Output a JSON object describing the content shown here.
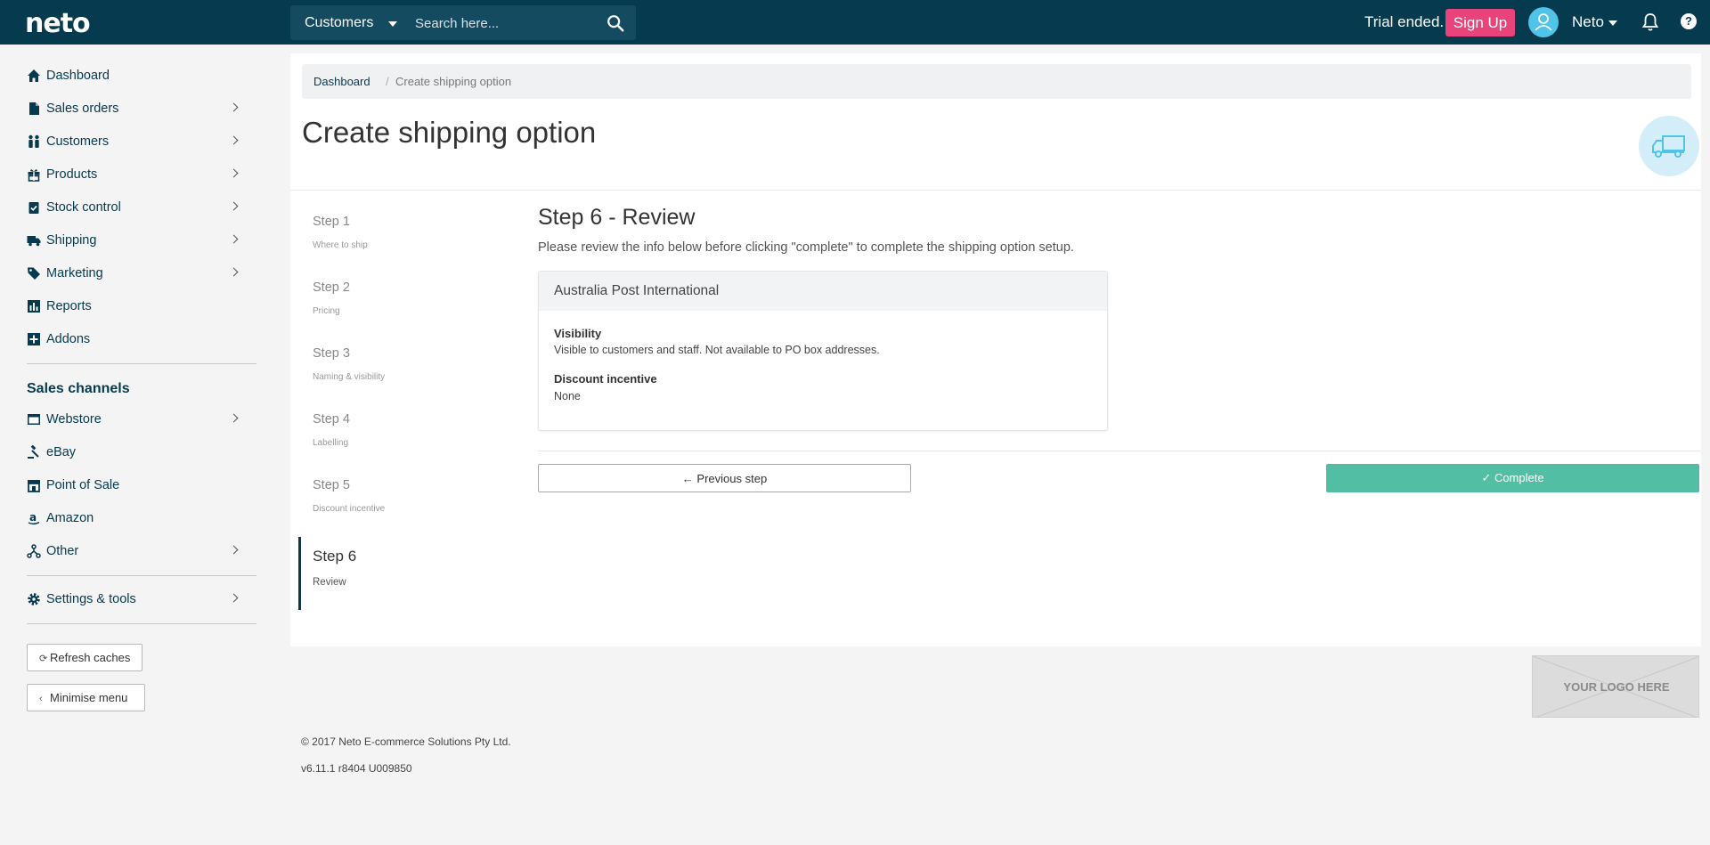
{
  "header": {
    "logo": "neto",
    "search_scope": "Customers",
    "search_placeholder": "Search here...",
    "trial_text": "Trial ended.",
    "signup_label": "Sign Up",
    "user_name": "Neto",
    "help_glyph": "?"
  },
  "sidebar": {
    "items": [
      {
        "label": "Dashboard",
        "icon": "home-icon"
      },
      {
        "label": "Sales orders",
        "icon": "document-icon"
      },
      {
        "label": "Customers",
        "icon": "people-icon"
      },
      {
        "label": "Products",
        "icon": "gift-icon"
      },
      {
        "label": "Stock control",
        "icon": "clipboard-check-icon"
      },
      {
        "label": "Shipping",
        "icon": "truck-icon"
      },
      {
        "label": "Marketing",
        "icon": "tag-icon"
      },
      {
        "label": "Reports",
        "icon": "bar-chart-icon"
      },
      {
        "label": "Addons",
        "icon": "plus-square-icon"
      }
    ],
    "sales_channels_title": "Sales channels",
    "channels": [
      {
        "label": "Webstore",
        "icon": "browser-icon"
      },
      {
        "label": "eBay",
        "icon": "gavel-icon"
      },
      {
        "label": "Point of Sale",
        "icon": "store-icon"
      },
      {
        "label": "Amazon",
        "icon": "amazon-icon"
      },
      {
        "label": "Other",
        "icon": "network-icon"
      }
    ],
    "settings_label": "Settings & tools",
    "refresh_label": "Refresh caches",
    "minimise_label": "Minimise menu"
  },
  "breadcrumb": {
    "home": "Dashboard",
    "separator": "/",
    "current": "Create shipping option"
  },
  "page_title": "Create shipping option",
  "steps": [
    {
      "title": "Step 1",
      "subtitle": "Where to ship"
    },
    {
      "title": "Step 2",
      "subtitle": "Pricing"
    },
    {
      "title": "Step 3",
      "subtitle": "Naming & visibility"
    },
    {
      "title": "Step 4",
      "subtitle": "Labelling"
    },
    {
      "title": "Step 5",
      "subtitle": "Discount incentive"
    },
    {
      "title": "Step 6",
      "subtitle": "Review"
    }
  ],
  "review": {
    "title": "Step 6 - Review",
    "description": "Please review the info below before clicking \"complete\" to complete the shipping option setup.",
    "card_title": "Australia Post International",
    "visibility_label": "Visibility",
    "visibility_value": "Visible to customers and staff. Not available to PO box addresses.",
    "discount_label": "Discount incentive",
    "discount_value": "None",
    "prev_label": "Previous step",
    "complete_label": "Complete"
  },
  "footer": {
    "logo_placeholder": "YOUR LOGO HERE",
    "copyright": "© 2017 Neto E-commerce Solutions Pty Ltd.",
    "version": "v6.11.1 r8404 U009850"
  },
  "colors": {
    "topbar": "#063a4f",
    "accent_pink": "#e8437a",
    "complete_green": "#52bfa4",
    "avatar_blue": "#4fc3e8"
  }
}
